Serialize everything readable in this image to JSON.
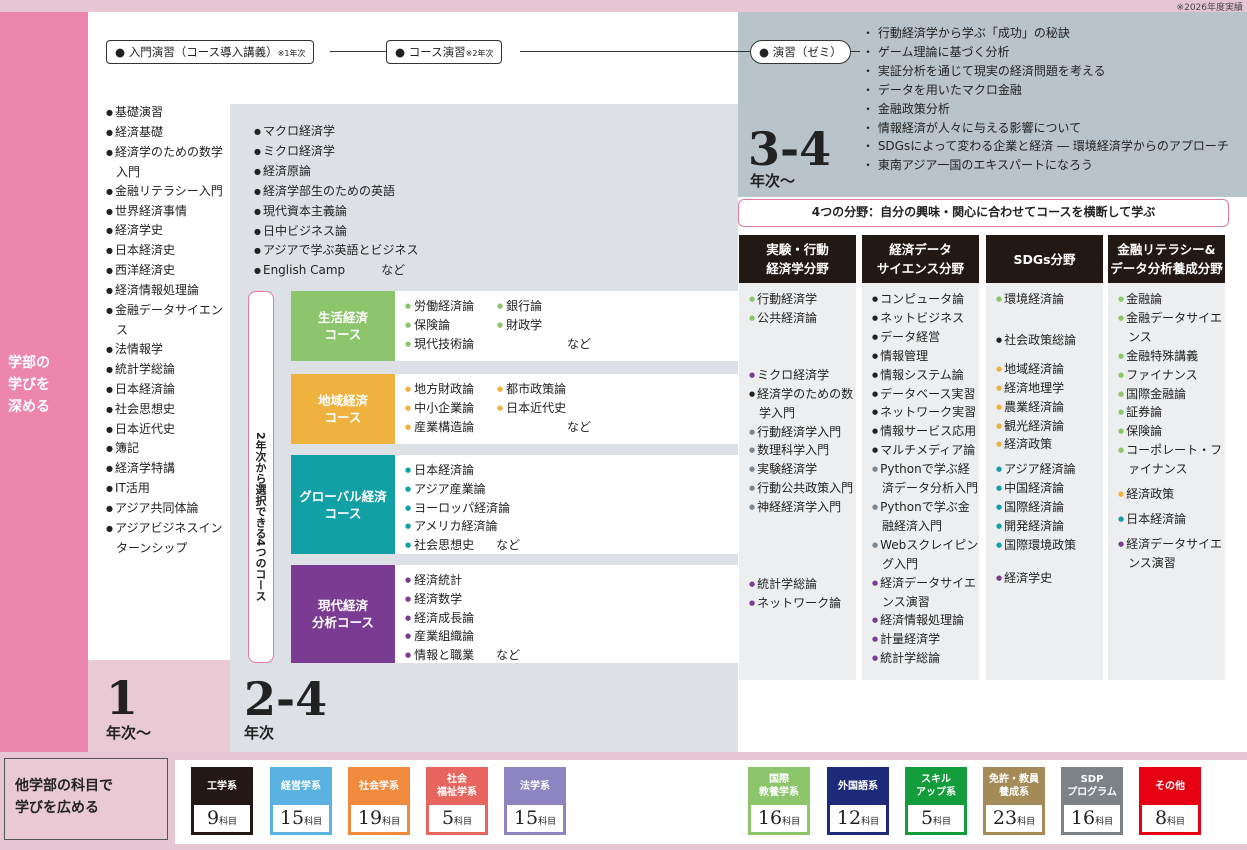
{
  "note": "※2026年度実績",
  "side_label": [
    "学部の",
    "学びを",
    "深める"
  ],
  "steps": [
    {
      "label": "● 入門演習（コース導入講義）",
      "small": "※1年次"
    },
    {
      "label": "● コース演習",
      "small": "※2年次"
    },
    {
      "label": "● 演習（ゼミ）",
      "small": ""
    }
  ],
  "year1": {
    "subjects": [
      "基礎演習",
      "経済基礎",
      "経済学のための数学入門",
      "金融リテラシー入門",
      "世界経済事情",
      "経済学史",
      "日本経済史",
      "西洋経済史",
      "経済情報処理論",
      "金融データサイエンス",
      "法情報学",
      "統計学総論",
      "日本経済論",
      "社会思想史",
      "日本近代史",
      "簿記",
      "経済学特講",
      "IT活用",
      "アジア共同体論",
      "アジアビジネスインターンシップ"
    ],
    "num": "1",
    "suffix": "年次〜"
  },
  "year24": {
    "subjects": [
      "マクロ経済学",
      "ミクロ経済学",
      "経済原論",
      "経済学部生のための英語",
      "現代資本主義論",
      "日中ビジネス論",
      "アジアで学ぶ英語とビジネス",
      "English Camp　　　など"
    ],
    "num": "2-4",
    "suffix": "年次",
    "vertical_label": "2年次から選択できる4つのコース"
  },
  "courses": [
    {
      "name": "生活経済\nコース",
      "color": "#8dc56c",
      "items": [
        "労働経済論",
        "銀行論",
        "保険論",
        "財政学",
        "現代技術論",
        "など"
      ]
    },
    {
      "name": "地域経済\nコース",
      "color": "#f0b23f",
      "items": [
        "地方財政論",
        "都市政策論",
        "中小企業論",
        "日本近代史",
        "産業構造論",
        "など"
      ]
    },
    {
      "name": "グローバル経済\nコース",
      "color": "#10a0a6",
      "items": [
        "日本経済論",
        "アジア産業論",
        "ヨーロッパ経済論",
        "アメリカ経済論",
        "社会思想史",
        "など"
      ]
    },
    {
      "name": "現代経済\n分析コース",
      "color": "#7a3c93",
      "items": [
        "経済統計",
        "経済数学",
        "経済成長論",
        "産業組織論",
        "情報と職業",
        "など"
      ]
    }
  ],
  "year34": {
    "num": "3-4",
    "suffix": "年次〜",
    "themes": [
      "行動経済学から学ぶ「成功」の秘訣",
      "ゲーム理論に基づく分析",
      "実証分析を通じて現実の経済問題を考える",
      "データを用いたマクロ金融",
      "金融政策分析",
      "情報経済が人々に与える影響について",
      "SDGsによって変わる企業と経済 ― 環境経済学からのアプローチ",
      "東南アジア一国のエキスパートになろう"
    ],
    "banner": "4つの分野：自分の興味・関心に合わせてコースを横断して学ぶ"
  },
  "fields": [
    {
      "title": "実験・行動\n経済学分野",
      "groups": [
        {
          "color": "#8dc56c",
          "items": [
            "行動経済学",
            "公共経済論"
          ]
        },
        {
          "color": "#7a3c93",
          "items": [
            "ミクロ経済学"
          ]
        },
        {
          "color": "#222",
          "items": [
            "経済学のための数学入門"
          ]
        },
        {
          "color": "#7a8791",
          "items": [
            "行動経済学入門",
            "数理科学入門",
            "実験経済学",
            "行動公共政策入門",
            "神経経済学入門"
          ]
        },
        {
          "color": "#7a3c93",
          "items": [
            "統計学総論",
            "ネットワーク論"
          ]
        }
      ]
    },
    {
      "title": "経済データ\nサイエンス分野",
      "groups": [
        {
          "color": "#222",
          "items": [
            "コンピュータ論",
            "ネットビジネス",
            "データ経営",
            "情報管理",
            "情報システム論",
            "データベース実習",
            "ネットワーク実習",
            "情報サービス応用",
            "マルチメディア論"
          ]
        },
        {
          "color": "#7a8791",
          "items": [
            "Pythonで学ぶ経済データ分析入門",
            "Pythonで学ぶ金融経済入門",
            "Webスクレイピング入門"
          ]
        },
        {
          "color": "#7a3c93",
          "items": [
            "経済データサイエンス演習",
            "経済情報処理論",
            "計量経済学",
            "統計学総論"
          ]
        }
      ]
    },
    {
      "title": "SDGs分野",
      "groups": [
        {
          "color": "#8dc56c",
          "items": [
            "環境経済論"
          ]
        },
        {
          "color": "#222",
          "items": [
            "社会政策総論"
          ]
        },
        {
          "color": "#f0b23f",
          "items": [
            "地域経済論",
            "経済地理学",
            "農業経済論",
            "観光経済論",
            "経済政策"
          ]
        },
        {
          "color": "#10a0a6",
          "items": [
            "アジア経済論",
            "中国経済論",
            "国際経済論",
            "開発経済論",
            "国際環境政策"
          ]
        },
        {
          "color": "#7a3c93",
          "items": [
            "経済学史"
          ]
        }
      ]
    },
    {
      "title": "金融リテラシー&\nデータ分析養成分野",
      "groups": [
        {
          "color": "#8dc56c",
          "items": [
            "金融論",
            "金融データサイエンス",
            "金融特殊講義",
            "ファイナンス",
            "国際金融論",
            "証券論",
            "保険論",
            "コーポレート・ファイナンス"
          ]
        },
        {
          "color": "#f0b23f",
          "items": [
            "経済政策"
          ]
        },
        {
          "color": "#10a0a6",
          "items": [
            "日本経済論"
          ]
        },
        {
          "color": "#7a3c93",
          "items": [
            "経済データサイエンス演習"
          ]
        }
      ]
    }
  ],
  "other": {
    "label": [
      "他学部の科目で",
      "学びを広める"
    ],
    "unit": "科目",
    "categories": [
      {
        "name": "工学系",
        "count": "9",
        "color": "#231815"
      },
      {
        "name": "経営学系",
        "count": "15",
        "color": "#5ab2e2"
      },
      {
        "name": "社会学系",
        "count": "19",
        "color": "#f08a3c"
      },
      {
        "name": "社会\n福祉学系",
        "count": "5",
        "color": "#e8645e"
      },
      {
        "name": "法学系",
        "count": "15",
        "color": "#8d84c2"
      },
      {
        "name": "国際\n教養学系",
        "count": "16",
        "color": "#8dc56c"
      },
      {
        "name": "外国語系",
        "count": "12",
        "color": "#1d2a7a"
      },
      {
        "name": "スキル\nアップ系",
        "count": "5",
        "color": "#129c3c"
      },
      {
        "name": "免許・教員\n養成系",
        "count": "23",
        "color": "#a58b57"
      },
      {
        "name": "SDP\nプログラム",
        "count": "16",
        "color": "#7d8287"
      },
      {
        "name": "その他",
        "count": "8",
        "color": "#e60012"
      }
    ]
  }
}
